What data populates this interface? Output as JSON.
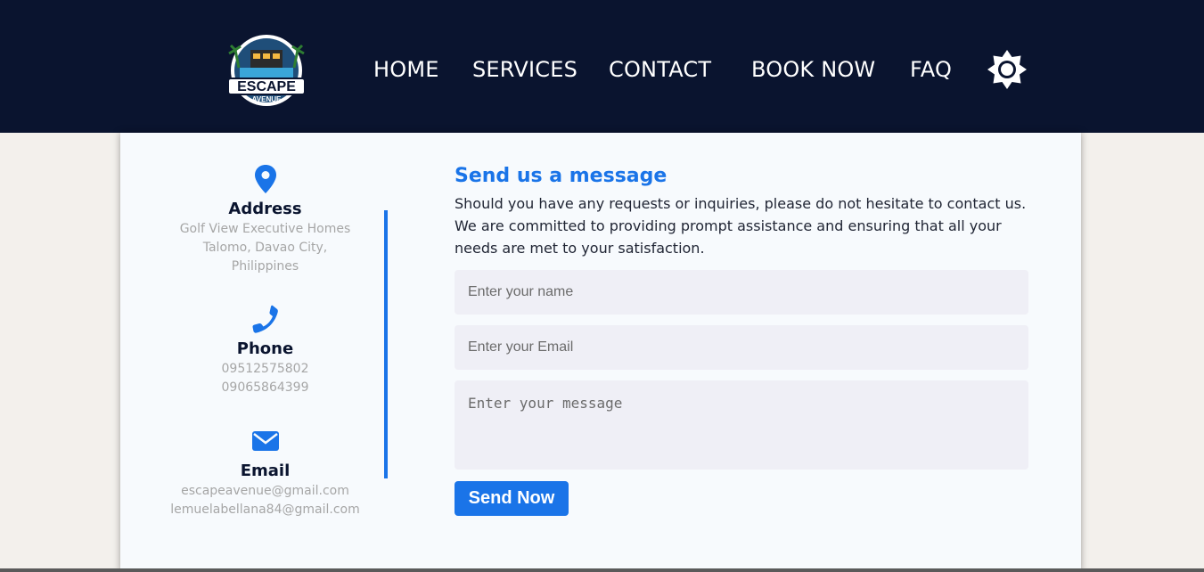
{
  "brand": {
    "logo_text": "ESCAPE",
    "logo_subtext": "AVENUE"
  },
  "nav": {
    "items": [
      {
        "label": "HOME"
      },
      {
        "label": "SERVICES"
      },
      {
        "label": "CONTACT"
      },
      {
        "label": "BOOK NOW"
      },
      {
        "label": "FAQ"
      }
    ],
    "theme_icon": "sun-icon"
  },
  "contact_info": {
    "address": {
      "icon": "location-pin-icon",
      "title": "Address",
      "lines": [
        "Golf View Executive Homes",
        "Talomo, Davao City,",
        "Philippines"
      ]
    },
    "phone": {
      "icon": "phone-icon",
      "title": "Phone",
      "lines": [
        "09512575802",
        "09065864399"
      ]
    },
    "email": {
      "icon": "envelope-icon",
      "title": "Email",
      "lines": [
        "escapeavenue@gmail.com",
        "lemuelabellana84@gmail.com"
      ]
    }
  },
  "form": {
    "title": "Send us a message",
    "description": "Should you have any requests or inquiries, please do not hesitate to contact us. We are committed to providing prompt assistance and ensuring that all your needs are met to your satisfaction.",
    "name_placeholder": "Enter your name",
    "email_placeholder": "Enter your Email",
    "message_placeholder": "Enter your message",
    "submit_label": "Send Now"
  },
  "colors": {
    "navbar": "#0a142f",
    "accent": "#1a74e8",
    "card": "#f7fafd",
    "page_bg": "#f3f0ec",
    "field_bg": "#efeff6"
  }
}
